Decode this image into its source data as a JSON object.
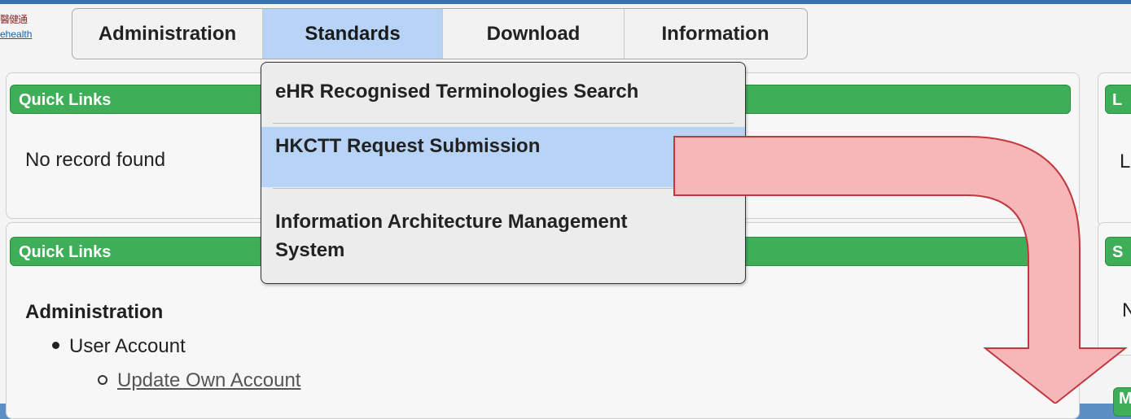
{
  "logo": {
    "chinese": "醫健通",
    "english": "ehealth"
  },
  "tabs": [
    {
      "label": "Administration"
    },
    {
      "label": "Standards"
    },
    {
      "label": "Download"
    },
    {
      "label": "Information"
    }
  ],
  "dropdown": {
    "items": [
      {
        "label": "eHR Recognised Terminologies Search"
      },
      {
        "label": "HKCTT Request Submission"
      },
      {
        "label": "Information Architecture Management System"
      }
    ],
    "item3_lines": [
      "Information Architecture Management",
      "System"
    ]
  },
  "panels": {
    "quick_links_1": {
      "title": "Quick Links",
      "empty_text": "No record found"
    },
    "quick_links_2": {
      "title": "Quick Links",
      "section": "Administration",
      "item": "User Account",
      "subitem": "Update Own Account"
    },
    "right_top": {
      "title_partial": "L",
      "body_partial": "L"
    },
    "right_mid": {
      "title_partial": "S",
      "body_partial": "N"
    },
    "right_bottom": {
      "title_partial": "M"
    }
  },
  "colors": {
    "panel_header": "#3fae58",
    "active_tab": "#b7d4f6",
    "arrow_fill": "#f7b6b8",
    "arrow_stroke": "#c0393e"
  }
}
